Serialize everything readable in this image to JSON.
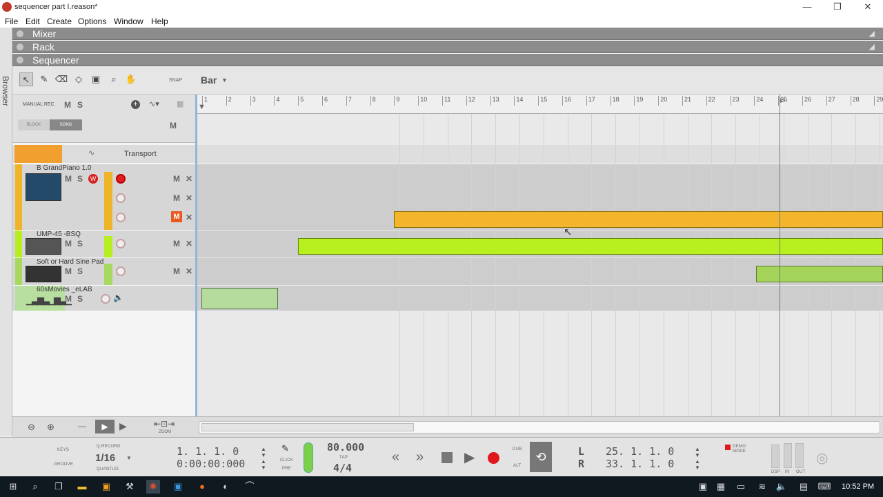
{
  "window": {
    "title": "sequencer part I.reason*",
    "minimize": "—",
    "restore": "❐",
    "close": "✕"
  },
  "menu": [
    "File",
    "Edit",
    "Create",
    "Options",
    "Window",
    "Help"
  ],
  "browser_label": "Browser",
  "panels": {
    "mixer": "Mixer",
    "rack": "Rack",
    "sequencer": "Sequencer"
  },
  "toolbar": {
    "snap_label": "SNAP",
    "snap_value": "Bar"
  },
  "track_header": {
    "manual_rec": "MANUAL REC",
    "m": "M",
    "s": "S",
    "block": "BLOCK",
    "song": "SONG",
    "m2": "M"
  },
  "transport_track": {
    "label": "Transport"
  },
  "tracks": [
    {
      "name": "B GrandPiano 1.0",
      "color": "#f0b428"
    },
    {
      "name": "UMP-45 -BSQ",
      "color": "#b6ee22"
    },
    {
      "name": "Soft or Hard Sine Pad",
      "color": "#a8d860"
    },
    {
      "name": "60sMovies _eLAB",
      "color": "#b8dea0"
    }
  ],
  "ruler": [
    "1",
    "2",
    "3",
    "4",
    "5",
    "6",
    "7",
    "8",
    "9",
    "10",
    "11",
    "12",
    "13",
    "14",
    "15",
    "16",
    "17",
    "18",
    "19",
    "20",
    "21",
    "22",
    "23",
    "24",
    "25",
    "26",
    "27",
    "28",
    "29"
  ],
  "zoom_label": "ZOOM",
  "transport": {
    "keys": "KEYS",
    "groove": "GROOVE",
    "qrecord": "Q.RECORD",
    "quantize_value": "1/16",
    "quantize": "QUANTIZE",
    "position_bars": "1.  1.  1.    0",
    "position_time": "0:00:00:000",
    "click": "CLICK",
    "pre": "PRE",
    "tempo": "80.000",
    "tap": "TAP",
    "signature": "4/4",
    "dub": "DUB",
    "alt": "ALT",
    "loop_l_label": "L",
    "loop_l": "25.  1.  1.    0",
    "loop_r_label": "R",
    "loop_r": "33.  1.  1.    0",
    "demo_mode": "DEMO MODE",
    "dsp": "DSP",
    "in": "IN",
    "out": "OUT"
  },
  "taskbar": {
    "time": "10:52 PM"
  }
}
